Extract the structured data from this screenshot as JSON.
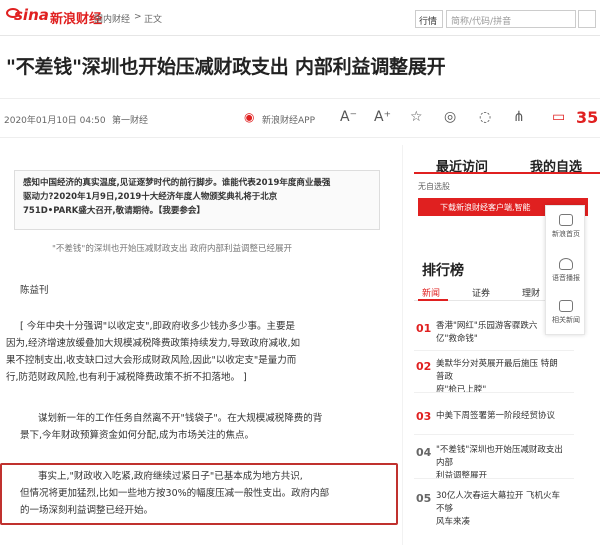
{
  "topbar": {
    "logo_text": "sina",
    "logo_cn": "新浪财经",
    "breadcrumb": [
      "国内财经",
      ">",
      "正文"
    ],
    "select_value": "行情",
    "search_placeholder": "简称/代码/拼音"
  },
  "article": {
    "title": "\"不差钱\"深圳也开始压减财政支出 内部利益调整展开",
    "date": "2020年01月10日 04:50",
    "source": "第一财经",
    "app_label": "新浪财经APP",
    "comment_count": "35",
    "intro_lines": [
      "感知中国经济的真实温度,见证逐梦时代的前行脚步。谁能代表2019年度商业最强",
      "驱动力?2020年1月9日,2019十大经济年度人物颁奖典礼将于北京",
      "751D•PARK盛大召开,敬请期待。【我要参会】"
    ],
    "image_caption": "\"不差钱\"的深圳也开始压减财政支出 政府内部利益调整已经展开",
    "author": "陈益刊",
    "paragraphs": [
      [
        "[ 今年中央十分强调\"以收定支\",即政府收多少钱办多少事。主要是",
        "因为,经济增速放缓叠加大规模减税降费政策持续发力,导致政府减收,如",
        "果不控制支出,收支缺口过大会形成财政风险,因此\"以收定支\"是量力而",
        "行,防范财政风险,也有利于减税降费政策不折不扣落地。 ]"
      ],
      [
        "谋划新一年的工作任务自然离不开\"钱袋子\"。在大规模减税降费的背",
        "景下,今年财政预算资金如何分配,成为市场关注的焦点。"
      ],
      [
        "事实上,\"财政收入吃紧,政府继续过紧日子\"已基本成为地方共识,",
        "但情况将更加猛烈,比如一些地方按30%的幅度压减一般性支出。政府内部",
        "的一场深刻利益调整已经开始。"
      ]
    ]
  },
  "sidebar": {
    "tab_recent": "最近访问",
    "tab_selected": "我的自选",
    "no_selection": "无自选股",
    "banner": "下载新浪财经客户端,智能",
    "rank_title": "排行榜",
    "rank_tabs": [
      "新闻",
      "证券",
      "理财"
    ],
    "rank_items": [
      {
        "num": "01",
        "text": [
          "香港\"网红\"乐园游客骤跌六",
          "亿\"救命钱\""
        ]
      },
      {
        "num": "02",
        "text": [
          "美默华分对英展开最后施压 特朗普政",
          "府\"枪已上膛\""
        ]
      },
      {
        "num": "03",
        "text": [
          "中美下周签署第一阶段经贸协议"
        ]
      },
      {
        "num": "04",
        "text": [
          "\"不差钱\"深圳也开始压减财政支出 内部",
          "利益调整展开"
        ]
      },
      {
        "num": "05",
        "text": [
          "30亿人次春运大幕拉开 飞机火车不够",
          "风车来凑"
        ]
      }
    ]
  },
  "sidetool": {
    "items": [
      "新浪首页",
      "语音播报",
      "相关新闻"
    ]
  },
  "colors": {
    "accent": "#e02020",
    "highlight_box": "#c0312e"
  }
}
